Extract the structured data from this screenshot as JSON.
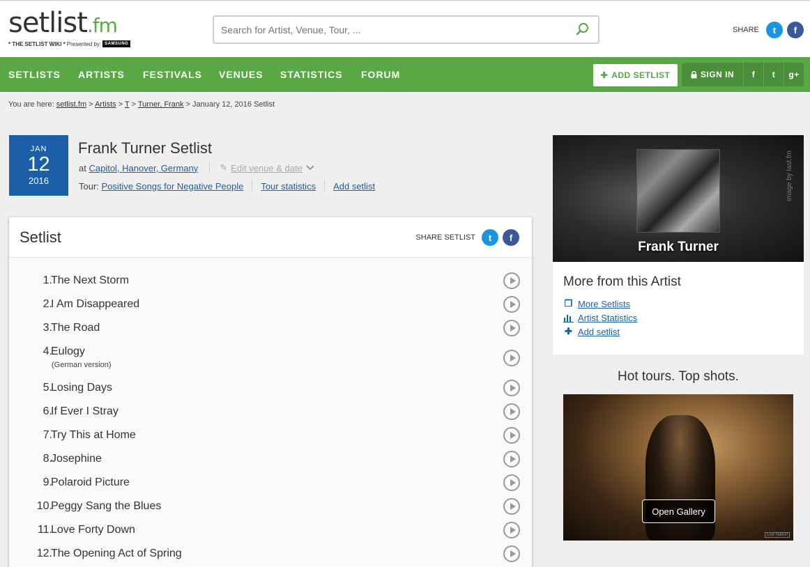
{
  "logo": {
    "main": "setlist",
    "suffix": ".fm",
    "tagline": "* THE SETLIST WIKI *",
    "presented": "Presented by:",
    "sponsor": "SAMSUNG"
  },
  "search": {
    "placeholder": "Search for Artist, Venue, Tour, ..."
  },
  "share_top": {
    "label": "SHARE"
  },
  "nav": {
    "items": [
      "SETLISTS",
      "ARTISTS",
      "FESTIVALS",
      "VENUES",
      "STATISTICS",
      "FORUM"
    ],
    "add_setlist": "ADD SETLIST",
    "sign_in": "SIGN IN"
  },
  "breadcrumb": {
    "prefix": "You are here:",
    "crumbs": [
      "setlist.fm",
      "Artists",
      "T",
      "Turner, Frank"
    ],
    "current": "January 12, 2016 Setlist"
  },
  "event": {
    "month": "JAN",
    "day": "12",
    "year": "2016",
    "title": "Frank Turner Setlist",
    "at": "at",
    "venue": "Capitol, Hanover, Germany",
    "edit": "Edit venue & date",
    "tour_label": "Tour:",
    "tour": "Positive Songs for Negative People",
    "tour_stats": "Tour statistics",
    "add_setlist": "Add setlist"
  },
  "setlist": {
    "heading": "Setlist",
    "share_label": "SHARE SETLIST",
    "songs": [
      {
        "num": "1.",
        "name": "The Next Storm"
      },
      {
        "num": "2.",
        "name": "I Am Disappeared"
      },
      {
        "num": "3.",
        "name": "The Road"
      },
      {
        "num": "4.",
        "name": "Eulogy",
        "info": "(German version)"
      },
      {
        "num": "5.",
        "name": "Losing Days"
      },
      {
        "num": "6.",
        "name": "If Ever I Stray"
      },
      {
        "num": "7.",
        "name": "Try This at Home"
      },
      {
        "num": "8.",
        "name": "Josephine"
      },
      {
        "num": "9.",
        "name": "Polaroid Picture"
      },
      {
        "num": "10.",
        "name": "Peggy Sang the Blues"
      },
      {
        "num": "11.",
        "name": "Love Forty Down"
      },
      {
        "num": "12.",
        "name": "The Opening Act of Spring"
      }
    ]
  },
  "artist_card": {
    "name": "Frank Turner",
    "credit": "image by last.fm",
    "more_title": "More from this Artist",
    "links": [
      "More Setlists",
      "Artist Statistics",
      "Add setlist"
    ]
  },
  "hot": {
    "title": "Hot tours. Top shots.",
    "button": "Open Gallery",
    "credit": "Live Nation"
  },
  "colors": {
    "brand_green": "#5aa845",
    "link_blue": "#1b5fa8",
    "twitter": "#1b95e0",
    "facebook": "#3b5998"
  }
}
